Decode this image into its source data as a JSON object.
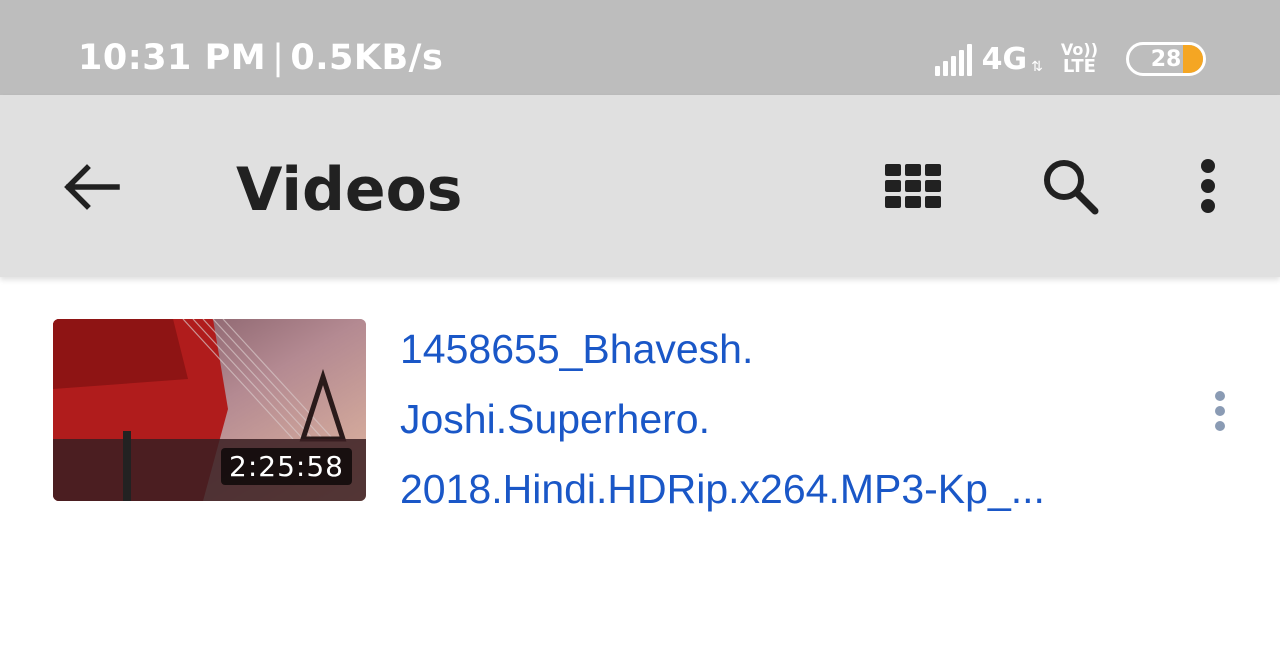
{
  "status_bar": {
    "time": "10:31 PM",
    "separator": "|",
    "net_speed": "0.5KB/s",
    "network_type": "4G",
    "volte_top": "Vo))",
    "volte_bottom": "LTE",
    "battery_level": "28",
    "signal_icon": "signal-bars-icon"
  },
  "app_bar": {
    "title": "Videos",
    "back_icon": "arrow-back-icon",
    "grid_icon": "grid-view-icon",
    "search_icon": "search-icon",
    "more_icon": "more-vert-icon"
  },
  "videos": [
    {
      "title_lines": [
        "1458655_Bhavesh.",
        "Joshi.Superhero.",
        "2018.Hindi.HDRip.x264.MP3-Kp_..."
      ],
      "duration": "2:25:58",
      "more_icon": "more-vert-icon"
    }
  ],
  "colors": {
    "status_bar_bg": "#bdbdbd",
    "app_bar_bg": "#e0e0e0",
    "title_text": "#212121",
    "video_title": "#1a57c7",
    "battery_fill": "#f5a623"
  }
}
